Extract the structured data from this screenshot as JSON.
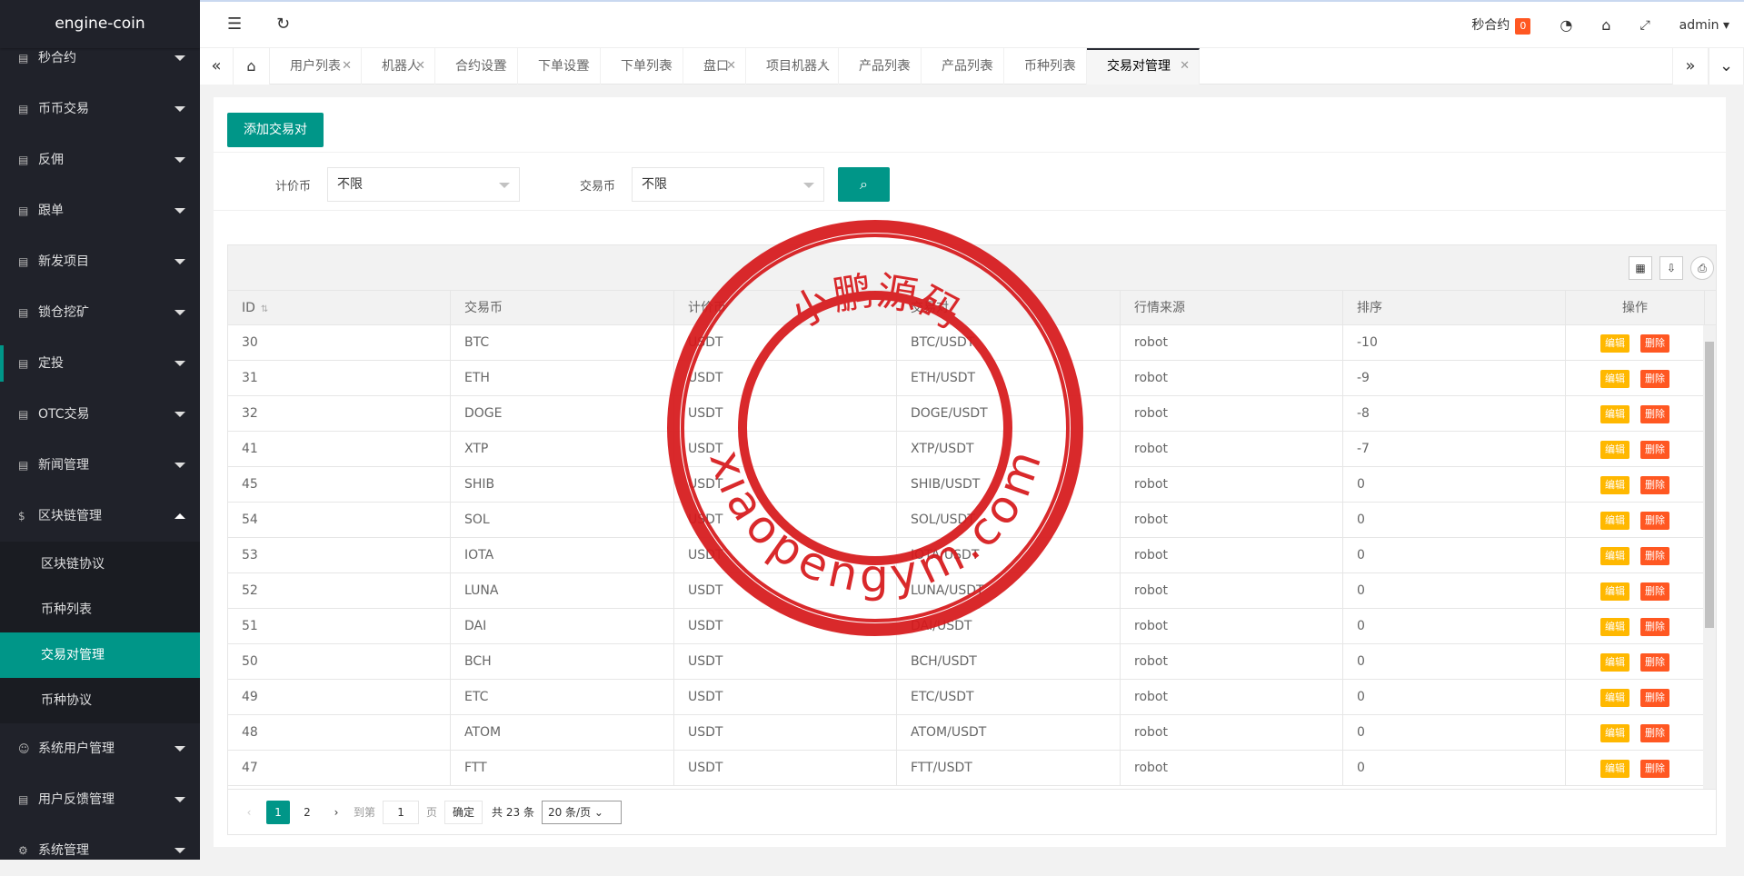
{
  "app": {
    "title": "engine-coin"
  },
  "sidebar": {
    "items": [
      {
        "label": "秒合约",
        "icon": "document-icon"
      },
      {
        "label": "币币交易",
        "icon": "document-icon"
      },
      {
        "label": "反佣",
        "icon": "document-icon"
      },
      {
        "label": "跟单",
        "icon": "document-icon"
      },
      {
        "label": "新发项目",
        "icon": "list-icon"
      },
      {
        "label": "锁仓挖矿",
        "icon": "document-icon"
      },
      {
        "label": "定投",
        "icon": "document-icon"
      },
      {
        "label": "OTC交易",
        "icon": "document-icon"
      },
      {
        "label": "新闻管理",
        "icon": "list-icon"
      },
      {
        "label": "区块链管理",
        "icon": "coin-icon"
      }
    ],
    "sub_items": [
      "区块链协议",
      "币种列表",
      "交易对管理",
      "币种协议"
    ],
    "bottom_items": [
      {
        "label": "系统用户管理",
        "icon": "user-icon"
      },
      {
        "label": "用户反馈管理",
        "icon": "list-icon"
      },
      {
        "label": "系统管理",
        "icon": "gear-icon"
      }
    ]
  },
  "header": {
    "menu_toggle": "☰",
    "refresh": "↻",
    "contract_label": "秒合约",
    "contract_count": "0",
    "user": "admin"
  },
  "tabs": [
    "用户列表",
    "机器人",
    "合约设置",
    "下单设置",
    "下单列表",
    "盘口",
    "项目机器人",
    "产品列表",
    "产品列表",
    "币种列表",
    "交易对管理"
  ],
  "toolbar": {
    "add_label": "添加交易对"
  },
  "filter": {
    "quote_label": "计价币",
    "quote_value": "不限",
    "base_label": "交易币",
    "base_value": "不限"
  },
  "table": {
    "headers": [
      "ID",
      "交易币",
      "计价币",
      "交易对",
      "行情来源",
      "排序",
      "操作"
    ],
    "edit_label": "编辑",
    "delete_label": "删除",
    "rows": [
      [
        "30",
        "BTC",
        "USDT",
        "BTC/USDT",
        "robot",
        "-10"
      ],
      [
        "31",
        "ETH",
        "USDT",
        "ETH/USDT",
        "robot",
        "-9"
      ],
      [
        "32",
        "DOGE",
        "USDT",
        "DOGE/USDT",
        "robot",
        "-8"
      ],
      [
        "41",
        "XTP",
        "USDT",
        "XTP/USDT",
        "robot",
        "-7"
      ],
      [
        "45",
        "SHIB",
        "USDT",
        "SHIB/USDT",
        "robot",
        "0"
      ],
      [
        "54",
        "SOL",
        "USDT",
        "SOL/USDT",
        "robot",
        "0"
      ],
      [
        "53",
        "IOTA",
        "USDT",
        "IOTA/USDT",
        "robot",
        "0"
      ],
      [
        "52",
        "LUNA",
        "USDT",
        "LUNA/USDT",
        "robot",
        "0"
      ],
      [
        "51",
        "DAI",
        "USDT",
        "DAI/USDT",
        "robot",
        "0"
      ],
      [
        "50",
        "BCH",
        "USDT",
        "BCH/USDT",
        "robot",
        "0"
      ],
      [
        "49",
        "ETC",
        "USDT",
        "ETC/USDT",
        "robot",
        "0"
      ],
      [
        "48",
        "ATOM",
        "USDT",
        "ATOM/USDT",
        "robot",
        "0"
      ],
      [
        "47",
        "FTT",
        "USDT",
        "FTT/USDT",
        "robot",
        "0"
      ]
    ]
  },
  "pager": {
    "pages": [
      "1",
      "2"
    ],
    "goto_label": "到第",
    "page_input": "1",
    "page_unit": "页",
    "confirm": "确定",
    "total": "共 23 条",
    "page_size": "20 条/页"
  },
  "watermark": {
    "top_text": "小鹏源码",
    "bottom_text": "xiaopengym.com",
    "color": "#d7191c"
  }
}
